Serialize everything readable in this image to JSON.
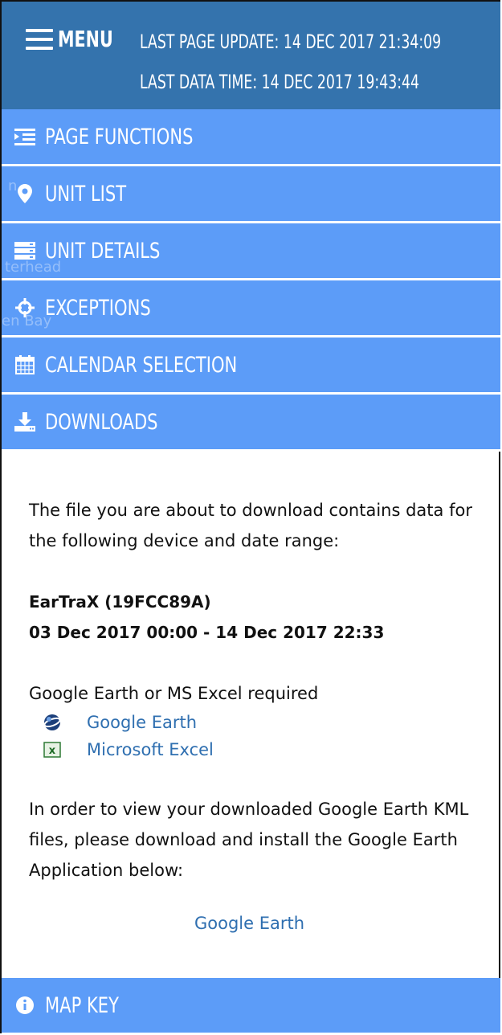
{
  "header": {
    "menu_label": "MENU",
    "last_page_update": "LAST PAGE UPDATE: 14 DEC 2017 21:34:09",
    "last_data_time": "LAST DATA TIME: 14 DEC 2017 19:43:44"
  },
  "nav": {
    "items": [
      {
        "label": "PAGE FUNCTIONS",
        "icon": "indent-list-icon"
      },
      {
        "label": "UNIT LIST",
        "icon": "map-marker-icon"
      },
      {
        "label": "UNIT DETAILS",
        "icon": "server-icon"
      },
      {
        "label": "EXCEPTIONS",
        "icon": "crosshair-icon"
      },
      {
        "label": "CALENDAR SELECTION",
        "icon": "calendar-icon"
      },
      {
        "label": "DOWNLOADS",
        "icon": "download-icon"
      }
    ],
    "ghost_text": [
      "terhead",
      "en Bay"
    ]
  },
  "downloads": {
    "intro": "The file you are about to download contains data for the following device and date range:",
    "device": "EarTraX (19FCC89A)",
    "date_range": "03 Dec 2017 00:00 - 14 Dec 2017 22:33",
    "requirement": "Google Earth or MS Excel required",
    "links": [
      {
        "label": "Google Earth",
        "icon": "google-earth-icon"
      },
      {
        "label": "Microsoft Excel",
        "icon": "excel-icon"
      }
    ],
    "install_note": "In order to view your downloaded Google Earth KML files, please download and install the Google Earth Application below:",
    "install_link": "Google Earth"
  },
  "map_key": {
    "label": "MAP KEY",
    "icon": "info-circle-icon"
  },
  "colors": {
    "header_bg": "#3473ad",
    "nav_bg": "#5c9cf8",
    "link": "#2f6fb0"
  }
}
